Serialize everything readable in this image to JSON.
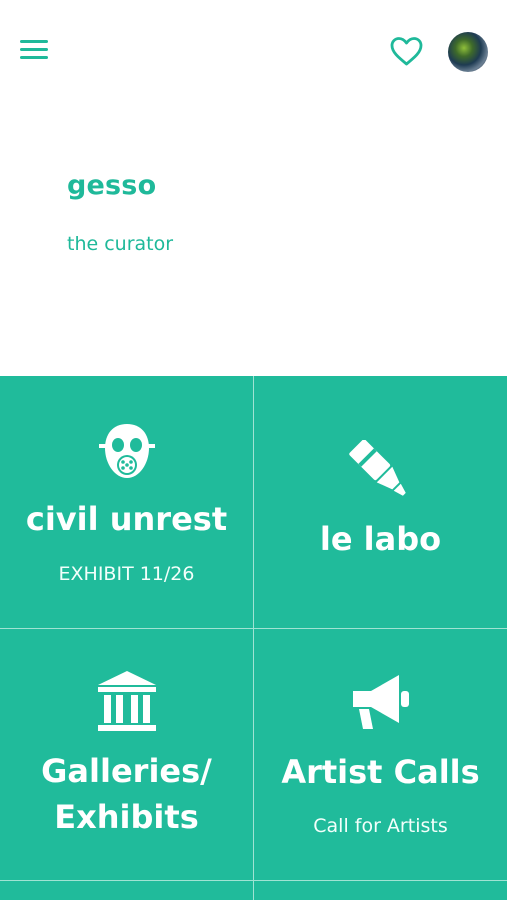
{
  "header": {
    "menu_icon": "hamburger-menu-icon",
    "favorites_icon": "heart-icon",
    "avatar_icon": "user-avatar"
  },
  "hero": {
    "title": "gesso",
    "subtitle": "the curator"
  },
  "tiles": [
    {
      "icon": "gas-mask-icon",
      "label": "civil unrest",
      "sublabel": "EXHIBIT 11/26"
    },
    {
      "icon": "marker-icon",
      "label": "le labo",
      "sublabel": ""
    },
    {
      "icon": "museum-icon",
      "label_line1": "Galleries/",
      "label_line2": "Exhibits",
      "sublabel": ""
    },
    {
      "icon": "megaphone-icon",
      "label": "Artist Calls",
      "sublabel": "Call for Artists"
    }
  ],
  "colors": {
    "accent": "#1fb99a",
    "tile_background": "#20bb9b",
    "tile_text": "#ffffff"
  }
}
